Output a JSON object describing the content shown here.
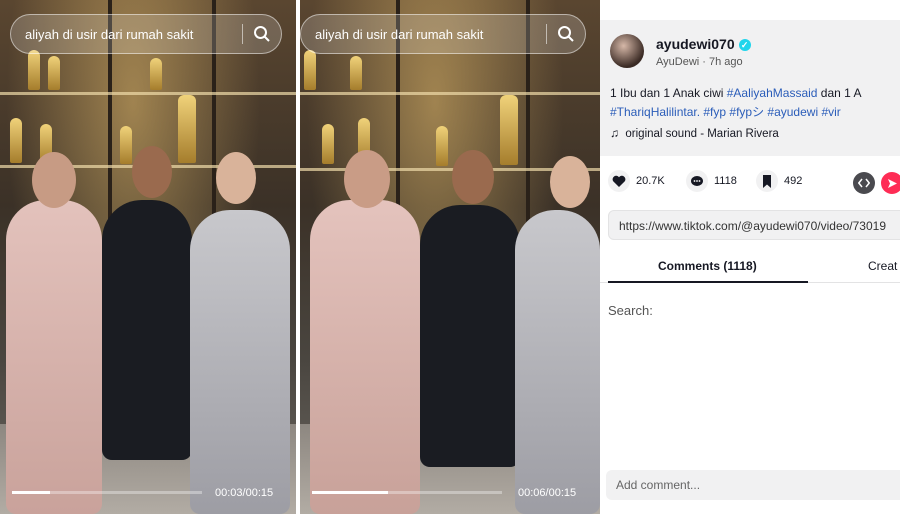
{
  "videos": [
    {
      "search_query": "aliyah di usir dari rumah sakit",
      "time": "00:03/00:15",
      "progress": 0.2
    },
    {
      "search_query": "aliyah di usir dari rumah sakit",
      "time": "00:06/00:15",
      "progress": 0.4
    }
  ],
  "post": {
    "username": "ayudewi070",
    "display_name": "AyuDewi",
    "posted": "7h ago",
    "separator": " · ",
    "caption_line1_text": "1 Ibu dan 1 Anak ciwi ",
    "caption_line1_tag": "#AaliyahMassaid",
    "caption_line1_tail": " dan 1 A",
    "caption_line2_tags": "#ThariqHalilintar. #fyp #fypシ #ayudewi #vir",
    "sound_label": "original sound - Marian Rivera",
    "likes": "20.7K",
    "comments": "1118",
    "saves": "492",
    "url": "https://www.tiktok.com/@ayudewi070/video/73019",
    "accent_color": "#fe2c55",
    "link_color": "#2b5db9"
  },
  "tabs": {
    "comments_label": "Comments (1118)",
    "creator_label": "Creat"
  },
  "comments": {
    "search_label": "Search:",
    "add_placeholder": "Add comment..."
  }
}
